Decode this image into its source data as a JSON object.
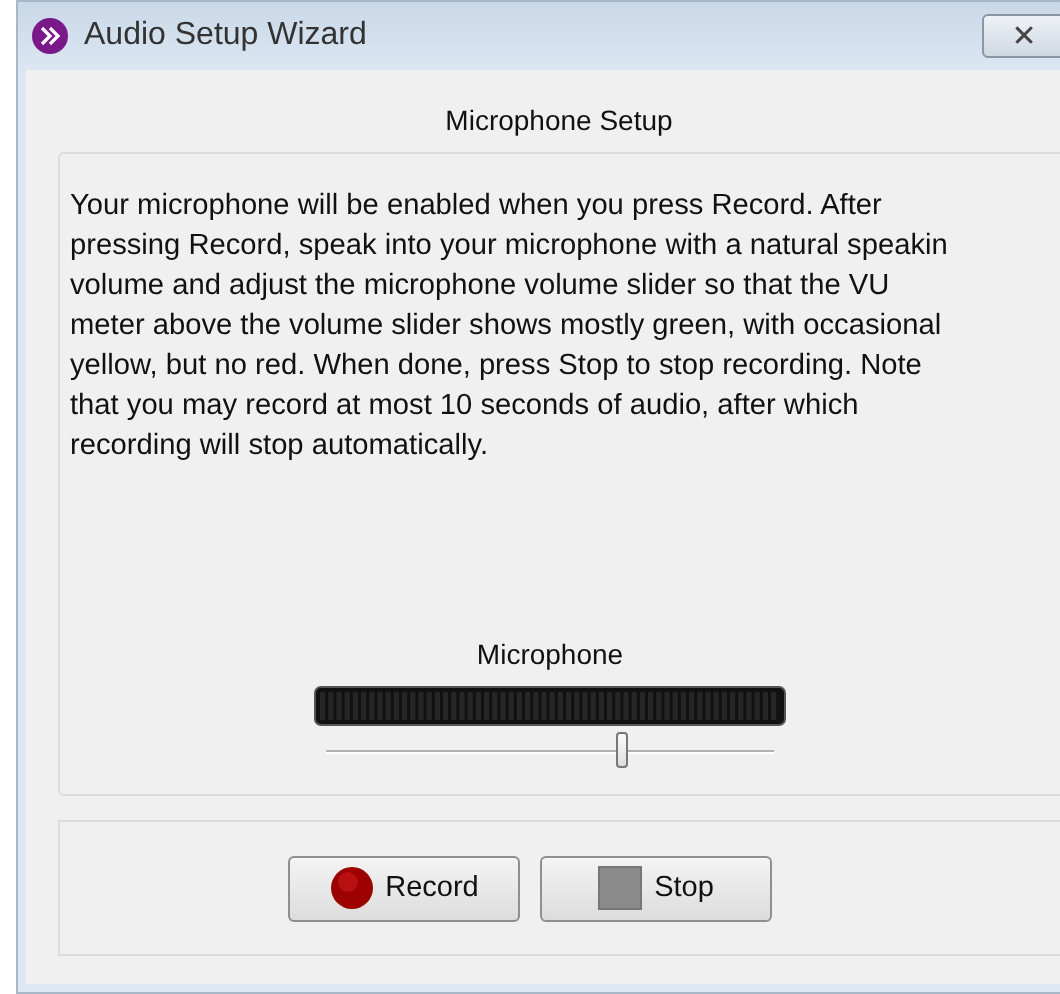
{
  "window": {
    "title": "Audio Setup Wizard",
    "close": "✕"
  },
  "section_title": "Microphone Setup",
  "instructions": "Your microphone will be enabled when you press Record. After\npressing Record, speak into your microphone with a natural speakin\nvolume and adjust the microphone volume slider so that the VU\nmeter above the volume slider shows mostly green, with occasional\nyellow, but no red. When done, press Stop to stop recording. Note\nthat you may record at most 10 seconds of audio, after which\nrecording will stop automatically.",
  "microphone": {
    "label": "Microphone",
    "volume": {
      "level": 0.66
    }
  },
  "buttons": [
    {
      "kind": "record",
      "label": "Record"
    },
    {
      "kind": "stop",
      "label": "Stop"
    }
  ]
}
